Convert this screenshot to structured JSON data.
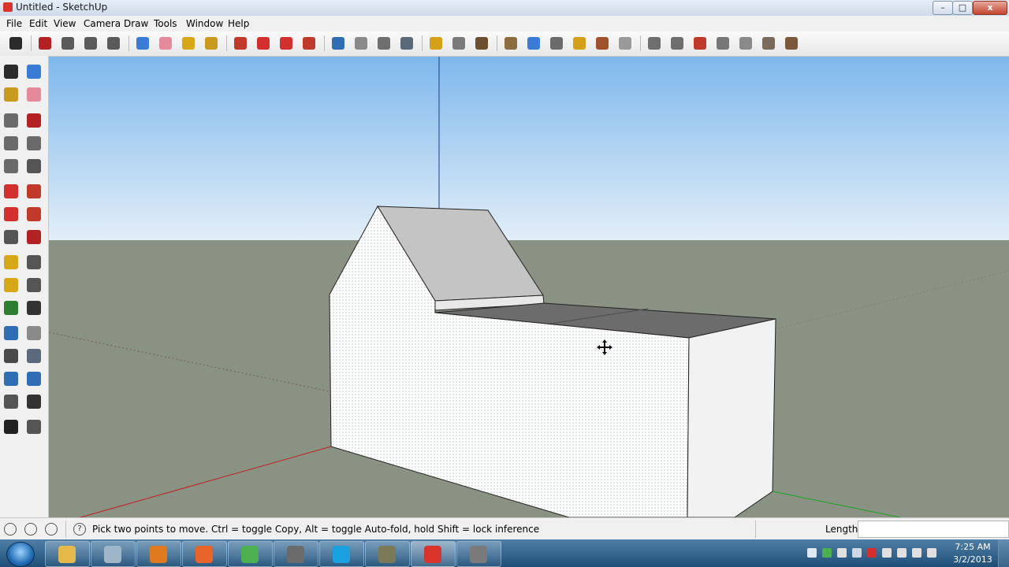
{
  "window": {
    "title": "Untitled - SketchUp",
    "min_label": "–",
    "max_label": "□",
    "close_label": "x"
  },
  "menubar": [
    "File",
    "Edit",
    "View",
    "Camera",
    "Draw",
    "Tools",
    "Window",
    "Help"
  ],
  "toolbar": {
    "items": [
      {
        "name": "select-tool-icon",
        "color": "#2b2b2b"
      },
      {
        "name": "line-tool-icon",
        "color": "#b22222"
      },
      {
        "name": "rectangle-tool-icon",
        "color": "#5a5a5a"
      },
      {
        "name": "circle-tool-icon",
        "color": "#5a5a5a"
      },
      {
        "name": "arc-tool-icon",
        "color": "#5a5a5a"
      },
      {
        "name": "make-component-icon",
        "color": "#3a7bd5"
      },
      {
        "name": "eraser-tool-icon",
        "color": "#e58a9a"
      },
      {
        "name": "tape-measure-icon",
        "color": "#d6a818"
      },
      {
        "name": "paint-bucket-icon",
        "color": "#c99a1e"
      },
      {
        "name": "push-pull-icon",
        "color": "#c0392b"
      },
      {
        "name": "move-tool-icon",
        "color": "#d32f2f"
      },
      {
        "name": "rotate-tool-icon",
        "color": "#d32f2f"
      },
      {
        "name": "follow-me-icon",
        "color": "#c0392b"
      },
      {
        "name": "orbit-tool-icon",
        "color": "#2f6db5"
      },
      {
        "name": "pan-tool-icon",
        "color": "#8a8a8a"
      },
      {
        "name": "zoom-tool-icon",
        "color": "#6f6f6f"
      },
      {
        "name": "zoom-extents-icon",
        "color": "#5a6a7a"
      },
      {
        "name": "get-models-icon",
        "color": "#d4a017"
      },
      {
        "name": "share-model-icon",
        "color": "#7a7a7a"
      },
      {
        "name": "share-component-icon",
        "color": "#6b4f2f"
      },
      {
        "name": "place-model-icon",
        "color": "#8c6d3f"
      },
      {
        "name": "geo-location-icon",
        "color": "#3a7bd5"
      },
      {
        "name": "iso-view-icon",
        "color": "#6b6b6b"
      },
      {
        "name": "top-view-icon",
        "color": "#d4a017"
      },
      {
        "name": "front-view-icon",
        "color": "#a0522d"
      },
      {
        "name": "right-view-icon",
        "color": "#9a9a9a"
      },
      {
        "name": "back-view-icon",
        "color": "#6e6e6e"
      },
      {
        "name": "left-view-icon",
        "color": "#6e6e6e"
      },
      {
        "name": "xray-style-icon",
        "color": "#c0392b"
      },
      {
        "name": "wireframe-style-icon",
        "color": "#777777"
      },
      {
        "name": "hidden-line-style-icon",
        "color": "#8a8a8a"
      },
      {
        "name": "shaded-style-icon",
        "color": "#7a6a5a"
      },
      {
        "name": "textured-style-icon",
        "color": "#7a5a3a"
      }
    ]
  },
  "lefttools": [
    {
      "name": "select-tool-icon",
      "color": "#2b2b2b"
    },
    {
      "name": "make-component-icon",
      "color": "#3a7bd5"
    },
    {
      "name": "paint-bucket-icon",
      "color": "#c99a1e"
    },
    {
      "name": "eraser-tool-icon",
      "color": "#e58a9a"
    },
    {
      "name": "rectangle-tool-icon",
      "color": "#6a6a6a"
    },
    {
      "name": "line-tool-icon",
      "color": "#b22222"
    },
    {
      "name": "circle-tool-icon",
      "color": "#6a6a6a"
    },
    {
      "name": "arc-tool-icon",
      "color": "#6a6a6a"
    },
    {
      "name": "polygon-tool-icon",
      "color": "#6a6a6a"
    },
    {
      "name": "freehand-tool-icon",
      "color": "#555555"
    },
    {
      "name": "move-tool-icon",
      "color": "#d32f2f"
    },
    {
      "name": "push-pull-icon",
      "color": "#c0392b"
    },
    {
      "name": "rotate-tool-icon",
      "color": "#d32f2f"
    },
    {
      "name": "follow-me-icon",
      "color": "#c0392b"
    },
    {
      "name": "scale-tool-icon",
      "color": "#555555"
    },
    {
      "name": "offset-tool-icon",
      "color": "#b22222"
    },
    {
      "name": "tape-measure-icon",
      "color": "#d6a818"
    },
    {
      "name": "dimension-tool-icon",
      "color": "#555555"
    },
    {
      "name": "protractor-icon",
      "color": "#d6a818"
    },
    {
      "name": "text-tool-icon",
      "color": "#555555"
    },
    {
      "name": "axes-tool-icon",
      "color": "#2e7d32"
    },
    {
      "name": "3d-text-icon",
      "color": "#333333"
    },
    {
      "name": "orbit-tool-icon",
      "color": "#2f6db5"
    },
    {
      "name": "pan-tool-icon",
      "color": "#8a8a8a"
    },
    {
      "name": "zoom-tool-icon",
      "color": "#4a4a4a"
    },
    {
      "name": "zoom-extents-icon",
      "color": "#5a6a7a"
    },
    {
      "name": "previous-view-icon",
      "color": "#2f6db5"
    },
    {
      "name": "next-view-icon",
      "color": "#2f6db5"
    },
    {
      "name": "position-camera-icon",
      "color": "#555555"
    },
    {
      "name": "look-around-icon",
      "color": "#333333"
    },
    {
      "name": "walk-tool-icon",
      "color": "#222222"
    },
    {
      "name": "section-plane-icon",
      "color": "#555555"
    }
  ],
  "status": {
    "text": "Pick two points to move.  Ctrl = toggle Copy, Alt = toggle Auto-fold, hold Shift = lock inference",
    "help_icon_label": "?",
    "length_label": "Length",
    "length_value": ""
  },
  "taskbar": {
    "apps": [
      {
        "name": "explorer-icon",
        "color": "#e5b84a"
      },
      {
        "name": "media-center-icon",
        "color": "#9fb6c8"
      },
      {
        "name": "media-player-icon",
        "color": "#e07a1f"
      },
      {
        "name": "firefox-icon",
        "color": "#e8652a"
      },
      {
        "name": "chrome-icon",
        "color": "#4caf50"
      },
      {
        "name": "tool-app-icon",
        "color": "#6b6b6b"
      },
      {
        "name": "skype-icon",
        "color": "#1aa1e0"
      },
      {
        "name": "generic-app-icon",
        "color": "#7a7a5a"
      },
      {
        "name": "sketchup-icon",
        "color": "#d9342b"
      },
      {
        "name": "screen-recorder-icon",
        "color": "#7a7a7a"
      }
    ],
    "tray": [
      {
        "name": "show-hidden-icons-icon",
        "color": "#dfe8f2"
      },
      {
        "name": "network-icon",
        "color": "#4caf50"
      },
      {
        "name": "mail-icon",
        "color": "#e0e0e0"
      },
      {
        "name": "monitor-icon",
        "color": "#cfd8e3"
      },
      {
        "name": "alert-icon",
        "color": "#d32f2f"
      },
      {
        "name": "volume-icon",
        "color": "#e0e0e0"
      },
      {
        "name": "usb-icon",
        "color": "#e0e0e0"
      },
      {
        "name": "flag-icon",
        "color": "#e0e0e0"
      },
      {
        "name": "signal-icon",
        "color": "#e0e0e0"
      }
    ],
    "time": "7:25 AM",
    "date": "3/2/2013"
  }
}
